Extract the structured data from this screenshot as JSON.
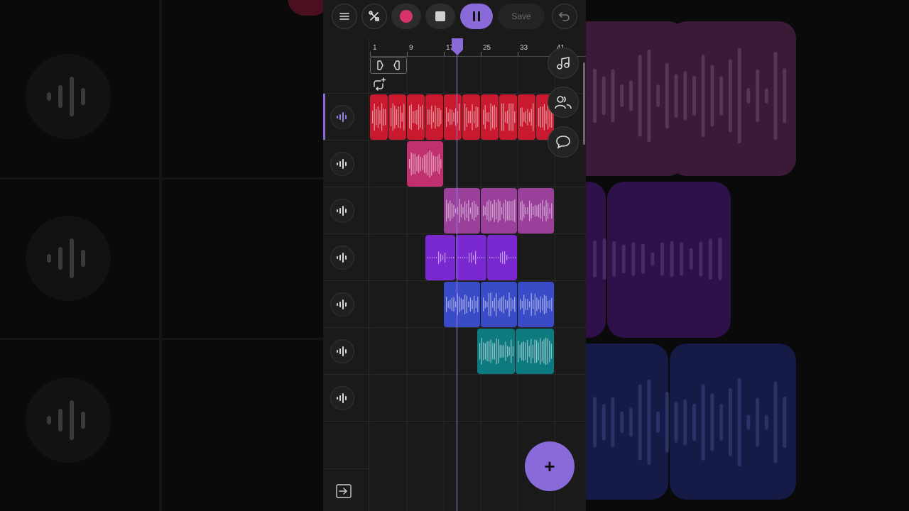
{
  "toolbar": {
    "save_label": "Save",
    "record_color": "#d6336c",
    "pause_color": "#8a6ad8"
  },
  "ruler": {
    "bars": [
      "1",
      "9",
      "17",
      "25",
      "33",
      "41"
    ]
  },
  "add_button_label": "+",
  "playhead_color": "#9b7fe8",
  "tracks": [
    {
      "color": "#c8192e",
      "selected": true
    },
    {
      "color": "#c0306e",
      "selected": false
    },
    {
      "color": "#9a3f9a",
      "selected": false
    },
    {
      "color": "#7a28d0",
      "selected": false
    },
    {
      "color": "#3a4bc8",
      "selected": false
    },
    {
      "color": "#0d7a80",
      "selected": false
    },
    {
      "color": "#404040",
      "selected": false
    }
  ],
  "icons": {
    "menu": "menu-icon",
    "tools": "tools-icon",
    "record": "record-icon",
    "stop": "stop-icon",
    "pause": "pause-icon",
    "undo": "undo-icon",
    "loop_region": "loop-region-icon",
    "add_loop": "add-loop-icon",
    "notes": "music-note-icon",
    "collab": "users-icon",
    "chat": "chat-icon",
    "collapse": "collapse-panel-icon",
    "track": "waveform-icon"
  }
}
